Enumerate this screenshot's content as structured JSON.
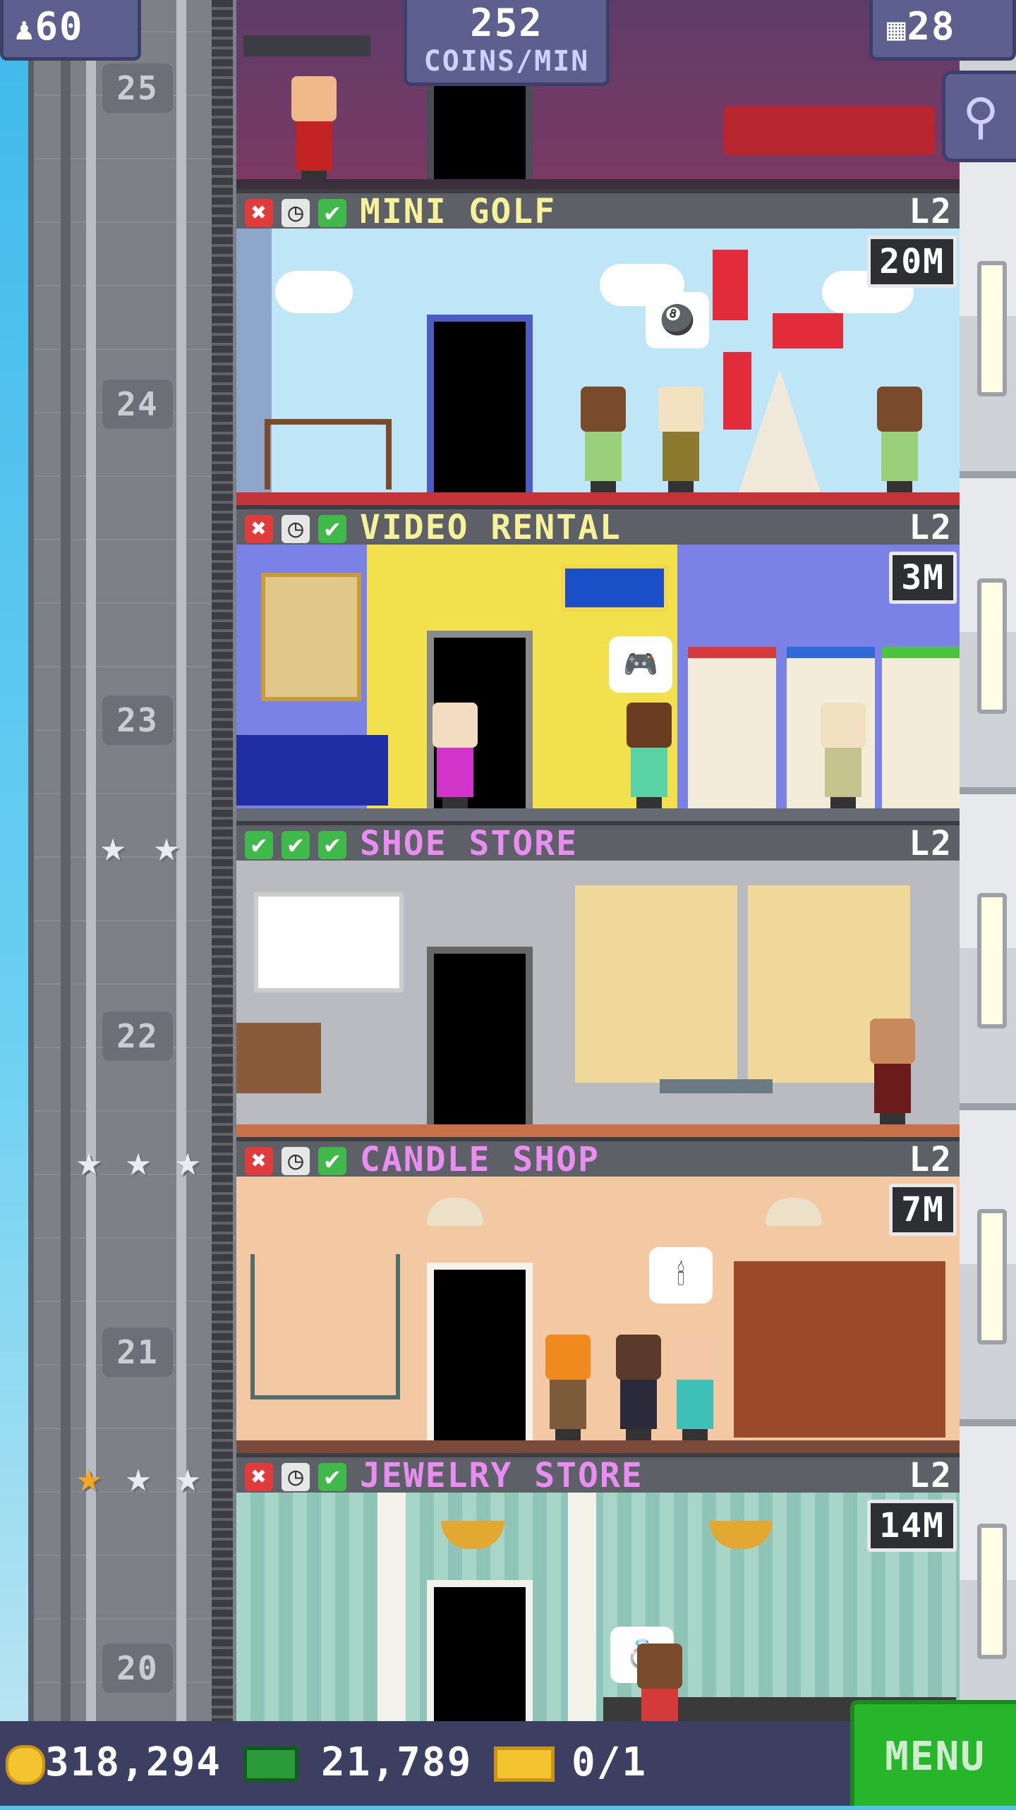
{
  "top_bar": {
    "population": "60",
    "coins_per_min_value": "252",
    "coins_per_min_label": "COINS/MIN",
    "floors": "28"
  },
  "floors": [
    {
      "number": "25"
    },
    {
      "number": "24",
      "name": "MINI GOLF",
      "level": "L2",
      "timer": "20M",
      "stock": [
        "x",
        "clock",
        "check"
      ],
      "name_color": "#f6f29a"
    },
    {
      "number": "23",
      "name": "VIDEO RENTAL",
      "level": "L2",
      "timer": "3M",
      "stock": [
        "x",
        "clock",
        "check"
      ],
      "name_color": "#f6f29a"
    },
    {
      "number": "22",
      "name": "SHOE STORE",
      "level": "L2",
      "stock": [
        "check",
        "check",
        "check"
      ],
      "name_color": "#e98ef0"
    },
    {
      "number": "21",
      "name": "CANDLE SHOP",
      "level": "L2",
      "timer": "7M",
      "stock": [
        "x",
        "clock",
        "check"
      ],
      "name_color": "#e98ef0"
    },
    {
      "number": "20",
      "name": "JEWELRY STORE",
      "level": "L2",
      "timer": "14M",
      "stock": [
        "x",
        "clock",
        "check"
      ],
      "name_color": "#e98ef0"
    }
  ],
  "bottom_bar": {
    "coins": "318,294",
    "bux": "21,789",
    "tickets": "0/1",
    "menu_label": "MENU"
  },
  "colors": {
    "accent_green": "#27b52b",
    "top_bar_bg": "#5d5f8e",
    "bottom_bar_bg": "#3c3e62"
  }
}
